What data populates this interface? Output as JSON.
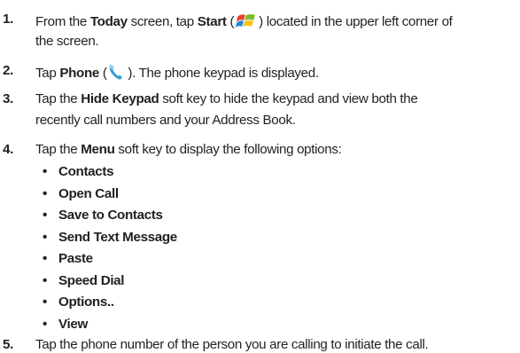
{
  "steps": [
    {
      "number": "1.",
      "parts": {
        "a": "From the ",
        "b": "Today",
        "c": " screen, tap ",
        "d": "Start",
        "e": " (",
        "f": ") located in the upper left corner of"
      },
      "line2": "the screen.",
      "icon": "windows-start-icon"
    },
    {
      "number": "2.",
      "parts": {
        "a": "Tap ",
        "b": "Phone",
        "c": " (",
        "d": " ). The phone keypad is displayed."
      },
      "icon": "phone-handset-icon"
    },
    {
      "number": "3.",
      "parts": {
        "a": "Tap the ",
        "b": "Hide Keypad",
        "c": " soft key to hide the keypad and view both the"
      },
      "line2": "recently call numbers and your Address Book."
    },
    {
      "number": "4.",
      "parts": {
        "a": "Tap the ",
        "b": "Menu",
        "c": " soft key to display the following options:"
      },
      "options": [
        "Contacts",
        "Open Call",
        "Save to Contacts",
        "Send Text Message",
        "Paste",
        "Speed Dial",
        "Options..",
        "View"
      ]
    },
    {
      "number": "5.",
      "parts": {
        "a": "Tap the phone number of the person you are calling to initiate the call."
      }
    }
  ],
  "bullet_glyph": "•",
  "colors": {
    "text": "#231f20",
    "phone_icon": "#3a9fd8"
  }
}
